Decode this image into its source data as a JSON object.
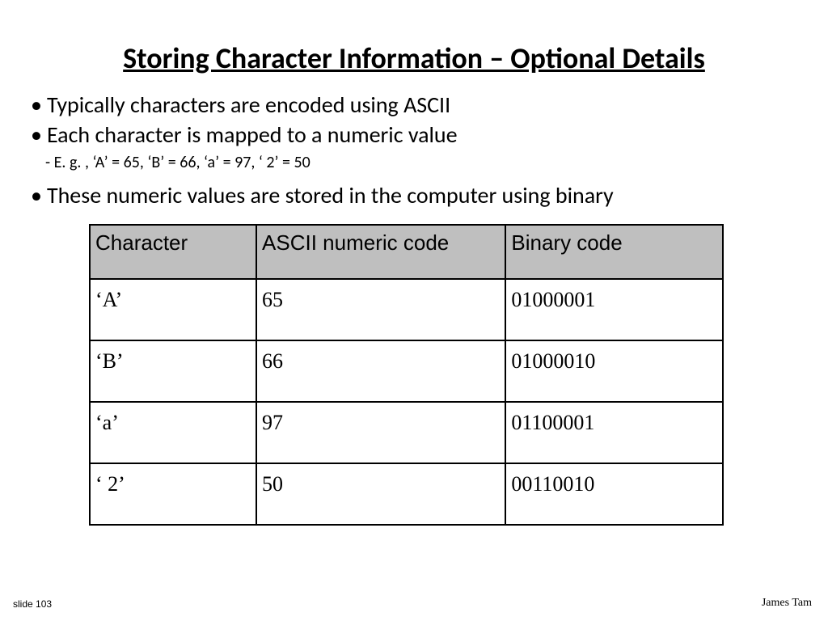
{
  "title": "Storing Character Information – Optional Details",
  "bullets": {
    "b1": "Typically characters are encoded using ASCII",
    "b2": "Each character is mapped to a numeric value",
    "sub1": "E. g. , ‘A’ = 65, ‘B’ = 66, ‘a’ = 97, ‘ 2’ = 50",
    "b3": "These numeric values are stored in the computer using binary"
  },
  "table": {
    "headers": {
      "char": "Character",
      "code": "ASCII numeric code",
      "binary": "Binary code"
    },
    "rows": [
      {
        "char": "‘A’",
        "code": "65",
        "binary": "01000001"
      },
      {
        "char": "‘B’",
        "code": "66",
        "binary": "01000010"
      },
      {
        "char": "‘a’",
        "code": "97",
        "binary": "01100001"
      },
      {
        "char": "‘ 2’",
        "code": "50",
        "binary": "00110010"
      }
    ]
  },
  "footer": {
    "left": "slide 103",
    "right": "James Tam"
  },
  "chart_data": {
    "type": "table",
    "title": "Storing Character Information – Optional Details",
    "columns": [
      "Character",
      "ASCII numeric code",
      "Binary code"
    ],
    "rows": [
      [
        "‘A’",
        65,
        "01000001"
      ],
      [
        "‘B’",
        66,
        "01000010"
      ],
      [
        "‘a’",
        97,
        "01100001"
      ],
      [
        "‘ 2’",
        50,
        "00110010"
      ]
    ]
  }
}
